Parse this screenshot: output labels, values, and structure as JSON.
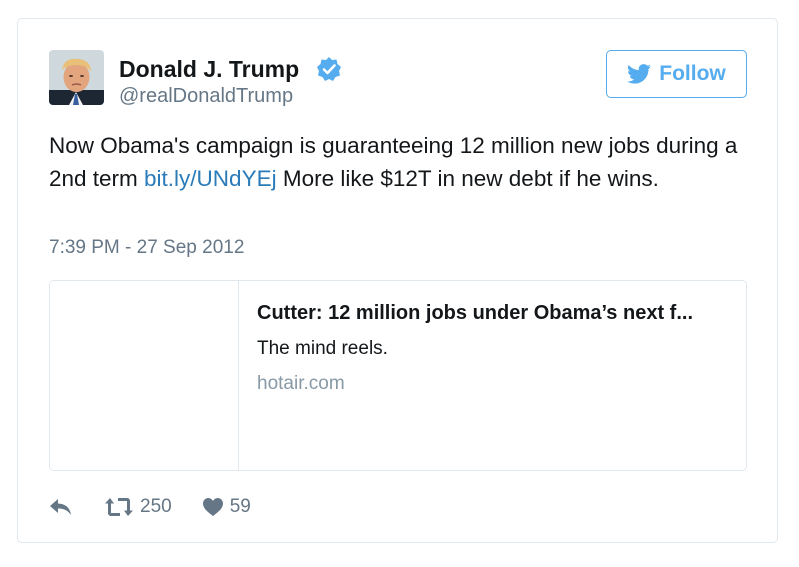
{
  "author": {
    "name": "Donald J. Trump",
    "handle": "@realDonaldTrump",
    "verified_icon": "verified-badge-icon"
  },
  "follow_button": {
    "label": "Follow",
    "icon": "twitter-bird-icon"
  },
  "tweet": {
    "text_before": "Now Obama's campaign is guaranteeing 12 million new jobs during a 2nd term ",
    "link_text": "bit.ly/UNdYEj",
    "text_after": " More like $12T in new debt if he wins.",
    "timestamp": "7:39 PM - 27 Sep 2012"
  },
  "link_card": {
    "title": "Cutter: 12 million jobs under Obama’s next f...",
    "description": "The mind reels.",
    "domain": "hotair.com"
  },
  "actions": {
    "reply_icon": "reply-icon",
    "retweet_icon": "retweet-icon",
    "retweet_count": "250",
    "like_icon": "heart-icon",
    "like_count": "59"
  },
  "colors": {
    "accent": "#55acee",
    "link": "#2b7bb9",
    "secondary_text": "#657786",
    "border": "#e1e8ed"
  }
}
